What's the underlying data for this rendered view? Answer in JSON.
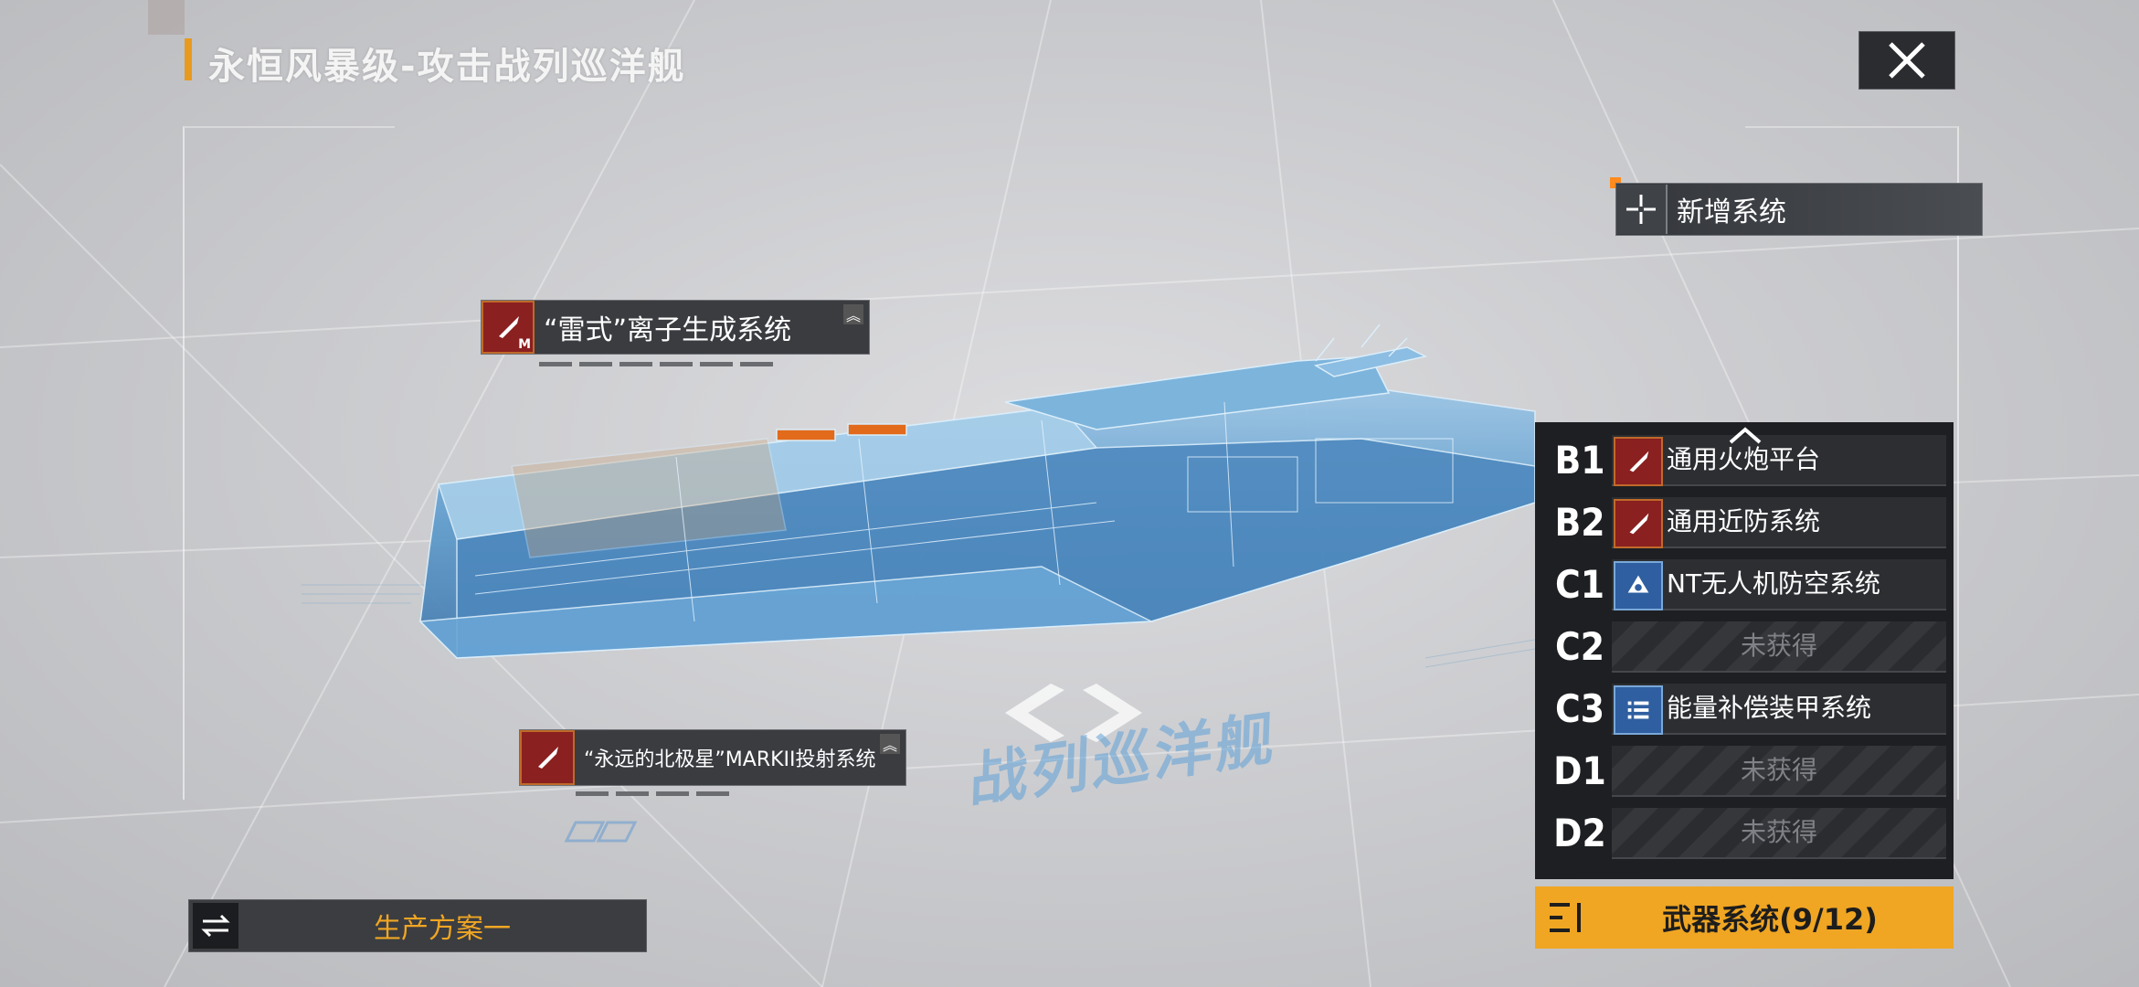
{
  "header": {
    "title": "永恒风暴级-攻击战列巡洋舰"
  },
  "add_system": {
    "label": "新增系统"
  },
  "callouts": [
    {
      "label": "“雷式”离子生成系统",
      "badge": "M"
    },
    {
      "label": "“永远的北极星”MARKII投射系统"
    }
  ],
  "weapon_slots": [
    {
      "slot": "B1",
      "name": "通用火炮平台",
      "icon": "missile-icon"
    },
    {
      "slot": "B2",
      "name": "通用近防系统",
      "icon": "missile-icon"
    },
    {
      "slot": "C1",
      "name": "NT无人机防空系统",
      "icon": "drone-icon"
    },
    {
      "slot": "C2",
      "name": "未获得",
      "icon": ""
    },
    {
      "slot": "C3",
      "name": "能量补偿装甲系统",
      "icon": "armor-list-icon"
    },
    {
      "slot": "D1",
      "name": "未获得",
      "icon": ""
    },
    {
      "slot": "D2",
      "name": "未获得",
      "icon": ""
    }
  ],
  "weapon_button": {
    "label": "武器系统(9/12)"
  },
  "production": {
    "label": "生产方案一"
  },
  "floor_label": "战列巡洋舰",
  "colors": {
    "accent": "#f0a623",
    "weapon_red": "#8a2020",
    "drone_blue": "#2f5fa0",
    "hull_blue": "#6aa9d8"
  }
}
